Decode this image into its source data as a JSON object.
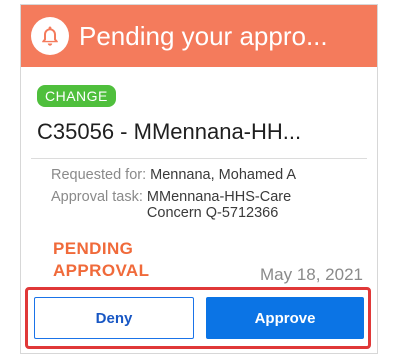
{
  "banner": {
    "title": "Pending your appro...",
    "icon": "bell-icon",
    "color": "#f47b5c"
  },
  "badge": {
    "label": "CHANGE",
    "color": "#4fbf3c"
  },
  "record": {
    "title": "C35056 - MMennana-HH..."
  },
  "details": {
    "requested_for_label": "Requested for:",
    "requested_for_value": "Mennana, Mohamed A",
    "approval_task_label": "Approval task:",
    "approval_task_value_line1": "MMennana-HHS-Care",
    "approval_task_value_line2": "Concern Q-5712366"
  },
  "status": {
    "line1": "PENDING",
    "line2": "APPROVAL",
    "color": "#f06a3a"
  },
  "date": "May 18, 2021",
  "actions": {
    "deny_label": "Deny",
    "approve_label": "Approve",
    "accent": "#0b74e5"
  }
}
